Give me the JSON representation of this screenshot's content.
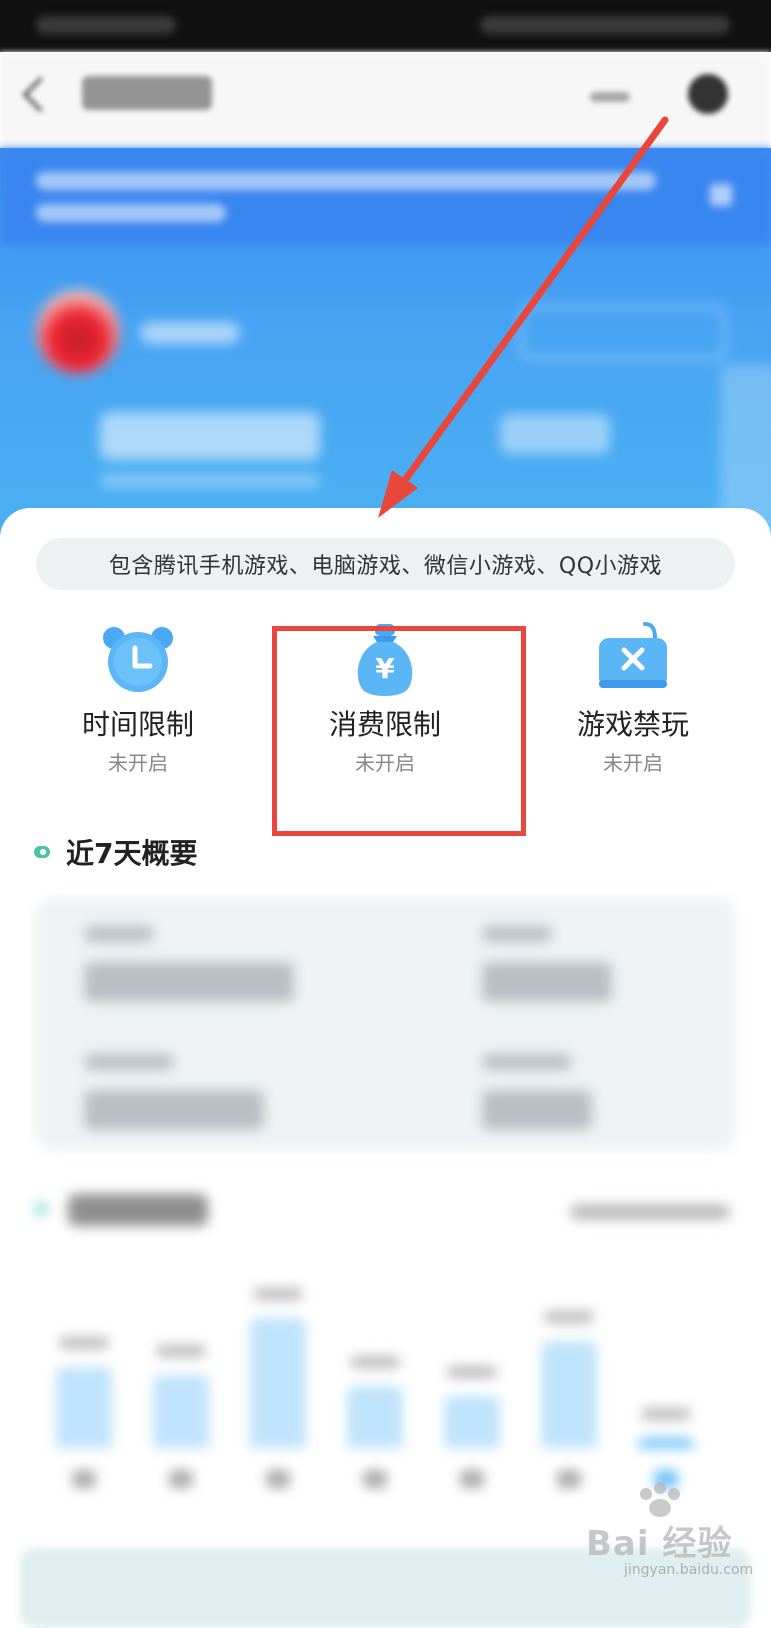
{
  "controls": {
    "scope_text": "包含腾讯手机游戏、电脑游戏、微信小游戏、QQ小游戏",
    "features": [
      {
        "label": "时间限制",
        "status": "未开启",
        "icon": "alarm-clock-icon"
      },
      {
        "label": "消费限制",
        "status": "未开启",
        "icon": "money-bag-icon"
      },
      {
        "label": "游戏禁玩",
        "status": "未开启",
        "icon": "gamepad-block-icon"
      }
    ]
  },
  "summary": {
    "title": "近7天概要"
  },
  "chart_data": {
    "type": "bar",
    "values_relative": [
      0.62,
      0.56,
      1.0,
      0.48,
      0.4,
      0.82,
      0.05
    ],
    "highlight_index": 6
  },
  "colors": {
    "accent_blue": "#4aa8f4",
    "highlight_red": "#e8473c",
    "section_dot": "#4fc3a8"
  },
  "watermark": {
    "text": "Bai 经验",
    "sub": "jingyan.baidu.com"
  }
}
